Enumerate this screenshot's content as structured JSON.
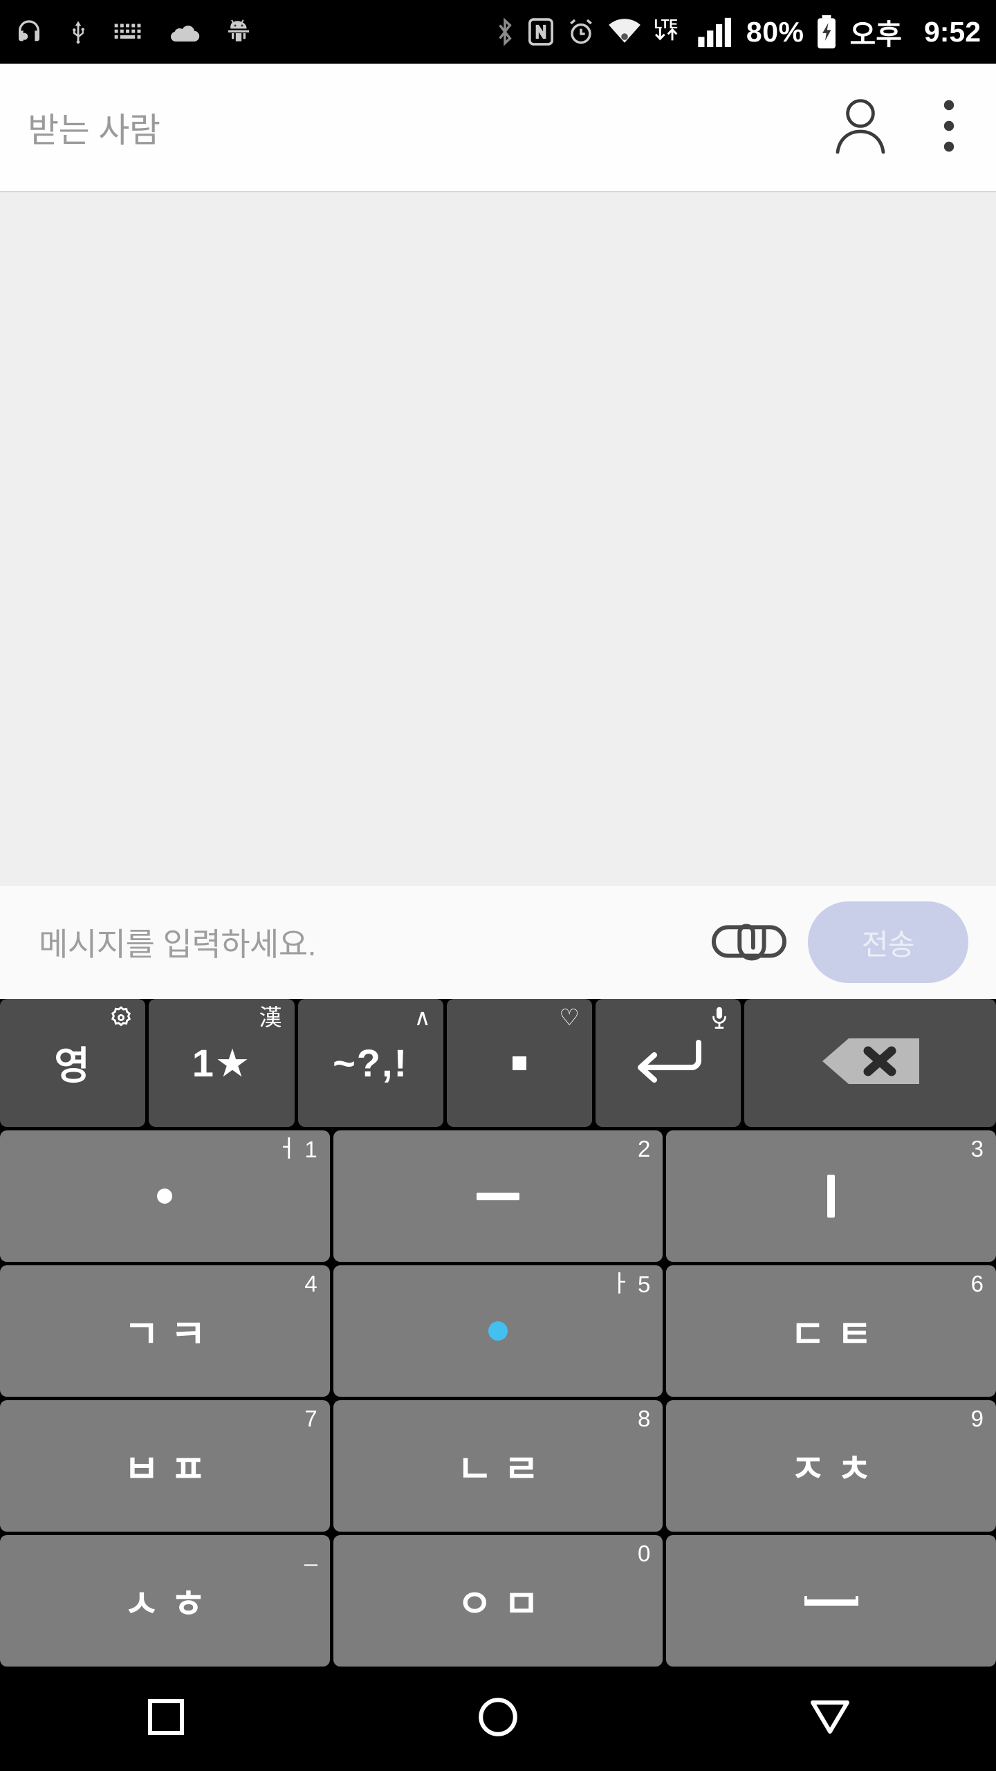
{
  "statusbar": {
    "icons_left": [
      "headset-icon",
      "usb-icon",
      "keyboard-icon",
      "cloud-icon",
      "android-debug-icon"
    ],
    "icons_right": [
      "bluetooth-icon",
      "nfc-icon",
      "alarm-icon",
      "wifi-icon",
      "lte-icon",
      "signal-icon"
    ],
    "lte_label": "LTE",
    "battery_percent": "80%",
    "ampm": "오후",
    "clock": "9:52"
  },
  "appbar": {
    "recipient_placeholder": "받는 사람",
    "recipient_value": "",
    "contacts_icon": "person-icon",
    "overflow_icon": "more-vertical-icon"
  },
  "thread": {
    "messages": []
  },
  "composer": {
    "placeholder": "메시지를 입력하세요.",
    "value": "",
    "attach_icon": "paperclip-icon",
    "send_label": "전송",
    "send_enabled": false,
    "send_bg": "#c9cfe8",
    "send_fg": "#eceff8"
  },
  "keyboard": {
    "type": "korean-cheonjiin",
    "rows": [
      [
        {
          "name": "key-english-toggle",
          "main": "영",
          "corner": "",
          "corner_icon": "gear-icon",
          "style": "dark"
        },
        {
          "name": "key-number-symbol",
          "main": "1★",
          "corner": "漢",
          "corner_icon": "",
          "style": "dark"
        },
        {
          "name": "key-punctuation",
          "main": "~?,!",
          "corner": "∧",
          "corner_icon": "",
          "style": "dark"
        },
        {
          "name": "key-period",
          "main": ".",
          "corner": "♡",
          "corner_icon": "",
          "style": "dark"
        },
        {
          "name": "key-enter",
          "main": "↵",
          "corner": "",
          "corner_icon": "mic-icon",
          "style": "dark"
        },
        {
          "name": "key-backspace",
          "main": "⌫",
          "corner": "",
          "corner_icon": "",
          "style": "dark"
        }
      ],
      [
        {
          "name": "key-dot-cheon",
          "main": "•",
          "corner": "1",
          "corner_hangul": "ㅓ",
          "style": "light"
        },
        {
          "name": "key-ji-horiz",
          "main": "ㅡ",
          "corner": "2",
          "corner_hangul": "",
          "style": "light"
        },
        {
          "name": "key-in-vert",
          "main": "ㅣ",
          "corner": "3",
          "corner_hangul": "",
          "style": "light"
        }
      ],
      [
        {
          "name": "key-giyeok-kieuk",
          "main": "ㄱㅋ",
          "corner": "4",
          "corner_hangul": "",
          "style": "light"
        },
        {
          "name": "key-dot-active",
          "main": "•",
          "corner": "5",
          "corner_hangul": "ㅏ",
          "style": "light",
          "active": true
        },
        {
          "name": "key-digeut-tieut",
          "main": "ㄷㅌ",
          "corner": "6",
          "corner_hangul": "",
          "style": "light"
        }
      ],
      [
        {
          "name": "key-bieup-pieup",
          "main": "ㅂㅍ",
          "corner": "7",
          "corner_hangul": "",
          "style": "light"
        },
        {
          "name": "key-nieun-rieul",
          "main": "ㄴㄹ",
          "corner": "8",
          "corner_hangul": "",
          "style": "light"
        },
        {
          "name": "key-jieut-chieut",
          "main": "ㅈㅊ",
          "corner": "9",
          "corner_hangul": "",
          "style": "light"
        }
      ],
      [
        {
          "name": "key-siot-hieut",
          "main": "ㅅㅎ",
          "corner": "_",
          "corner_hangul": "",
          "style": "light"
        },
        {
          "name": "key-ieung-mieum",
          "main": "ㅇㅁ",
          "corner": "0",
          "corner_hangul": "",
          "style": "light"
        },
        {
          "name": "key-space",
          "main": "␣",
          "corner": "",
          "corner_hangul": "",
          "style": "light"
        }
      ]
    ]
  },
  "navbar": {
    "recent_icon": "square-icon",
    "home_icon": "circle-icon",
    "back_icon": "triangle-down-icon"
  }
}
